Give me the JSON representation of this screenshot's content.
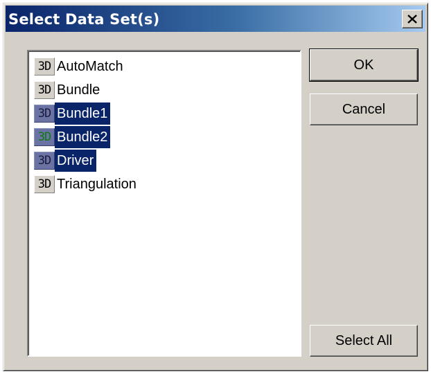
{
  "dialog": {
    "title": "Select Data Set(s)",
    "close_glyph": "×"
  },
  "list": {
    "items": [
      {
        "icon_text": "3D",
        "label": "AutoMatch",
        "selected": false,
        "icon_color": "#000000"
      },
      {
        "icon_text": "3D",
        "label": "Bundle",
        "selected": false,
        "icon_color": "#000000"
      },
      {
        "icon_text": "3D",
        "label": "Bundle1",
        "selected": true,
        "icon_color": "#1a1a3a"
      },
      {
        "icon_text": "3D",
        "label": "Bundle2",
        "selected": true,
        "icon_color": "#0f7a0f"
      },
      {
        "icon_text": "3D",
        "label": "Driver",
        "selected": true,
        "icon_color": "#1a1a3a"
      },
      {
        "icon_text": "3D",
        "label": "Triangulation",
        "selected": false,
        "icon_color": "#000000"
      }
    ]
  },
  "buttons": {
    "ok": "OK",
    "cancel": "Cancel",
    "select_all": "Select All"
  },
  "colors": {
    "selection": "#0a246a",
    "face": "#d4d0c8"
  }
}
